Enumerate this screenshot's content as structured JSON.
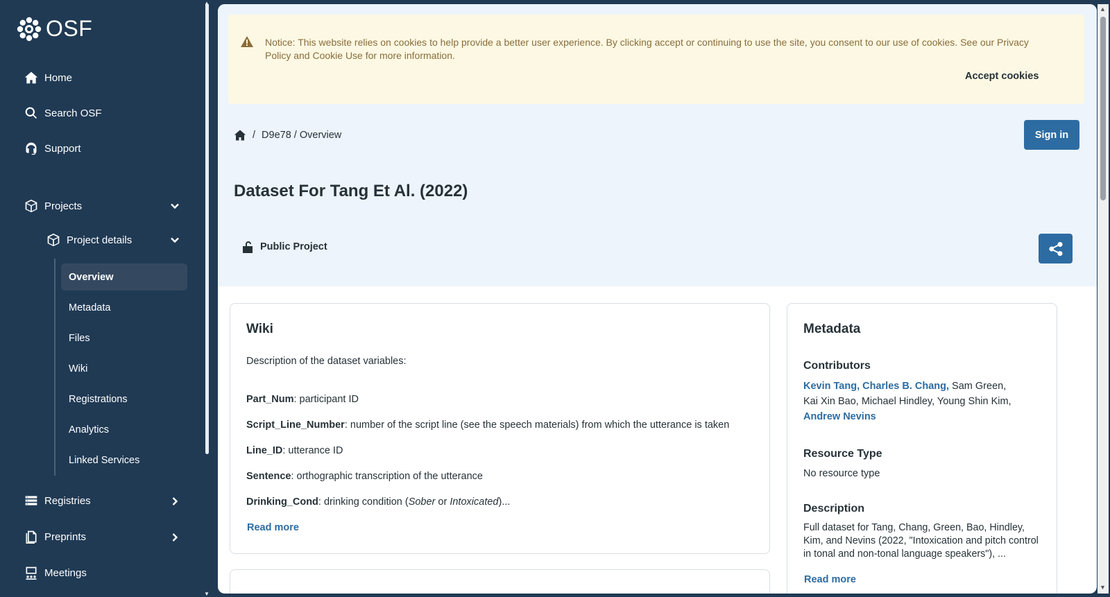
{
  "app": {
    "logo_text": "OSF"
  },
  "sidebar": {
    "items": [
      {
        "label": "Home",
        "icon": "home-icon"
      },
      {
        "label": "Search OSF",
        "icon": "search-icon"
      },
      {
        "label": "Support",
        "icon": "headset-icon"
      },
      {
        "label": "Projects",
        "icon": "cube-icon"
      },
      {
        "label": "Project details",
        "icon": "cube-icon"
      },
      {
        "label": "Registries",
        "icon": "registries-icon"
      },
      {
        "label": "Preprints",
        "icon": "preprints-icon"
      },
      {
        "label": "Meetings",
        "icon": "meetings-icon"
      }
    ],
    "subitems": [
      {
        "label": "Overview",
        "active": true
      },
      {
        "label": "Metadata"
      },
      {
        "label": "Files"
      },
      {
        "label": "Wiki"
      },
      {
        "label": "Registrations"
      },
      {
        "label": "Analytics"
      },
      {
        "label": "Linked Services"
      }
    ]
  },
  "cookie": {
    "message": "Notice: This website relies on cookies to help provide a better user experience. By clicking accept or continuing to use the site, you consent to our use of cookies. See our Privacy Policy and Cookie Use for more information.",
    "accept_label": "Accept cookies"
  },
  "breadcrumb": {
    "path": "D9e78 / Overview",
    "separator": "/"
  },
  "header": {
    "signin_label": "Sign in",
    "title": "Dataset For Tang Et Al. (2022)",
    "visibility": "Public Project"
  },
  "wiki": {
    "title": "Wiki",
    "description": "Description of the dataset variables:",
    "lines": [
      {
        "key": "Part_Num",
        "text": ": participant ID"
      },
      {
        "key": "Script_Line_Number",
        "text": ": number of the script line (see the speech materials) from which the utterance is taken"
      },
      {
        "key": "Line_ID",
        "text": ": utterance ID"
      },
      {
        "key": "Sentence",
        "text": ": orthographic transcription of the utterance"
      },
      {
        "key": "Drinking_Cond",
        "text_pre": ": drinking condition (",
        "em1": "Sober",
        "mid": " or ",
        "em2": "Intoxicated",
        "text_post": ")..."
      }
    ],
    "read_more": "Read more"
  },
  "metadata": {
    "title": "Metadata",
    "contributors_heading": "Contributors",
    "contributors_linked_1": "Kevin Tang, Charles B. Chang,",
    "contributors_plain_1": " Sam Green,",
    "contributors_plain_2": "Kai Xin Bao, Michael Hindley, Young Shin Kim,",
    "contributors_linked_2": "Andrew Nevins",
    "resource_type_heading": "Resource Type",
    "resource_type": "No resource type",
    "description_heading": "Description",
    "description": "Full dataset for Tang, Chang, Green, Bao, Hindley, Kim, and Nevins (2022, \"Intoxication and pitch control in tonal and non-tonal language speakers\"), ...",
    "read_more": "Read more"
  },
  "colors": {
    "sidebar_bg": "#203a54",
    "accent": "#2d6ca2",
    "hero_bg": "#edf4fb",
    "cookie_bg": "#fcf8e3",
    "cookie_text": "#8a6d3b"
  }
}
